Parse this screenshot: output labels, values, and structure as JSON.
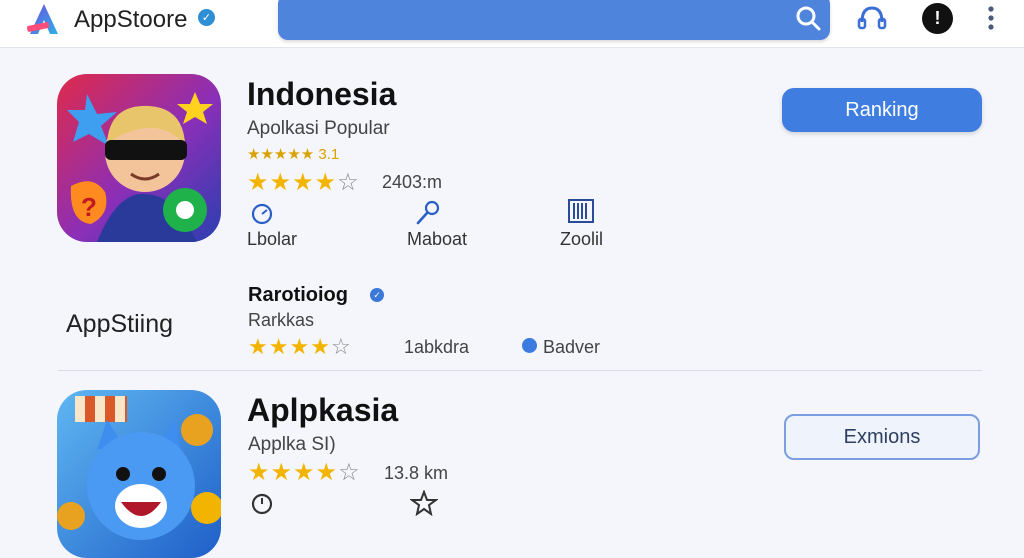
{
  "header": {
    "brand": "AppStoore",
    "colors": {
      "search_bar": "#4e84dc",
      "brand_badge": "#2f8fd6"
    },
    "icons": [
      "appstore-logo-icon",
      "verified-icon",
      "search-icon",
      "headset-icon",
      "alert-icon",
      "more-vertical-icon"
    ]
  },
  "featured": {
    "title": "Indonesia",
    "subtitle": "Apolkasi Popular",
    "small_rating_text": "★★★★★ 3.1",
    "rating_stars": 4,
    "downloads": "2403:m",
    "stats": [
      {
        "icon": "gauge-icon",
        "label": "Lbolar"
      },
      {
        "icon": "microphone-icon",
        "label": "Maboat"
      },
      {
        "icon": "barcode-icon",
        "label": "Zoolil"
      }
    ],
    "button_label": "Ranking"
  },
  "developer": {
    "side_label": "AppStiing",
    "title": "Rarotioiog",
    "subtitle": "Rarkkas",
    "rating_stars": 4,
    "count": "1abkdra",
    "badge_label": "Badver",
    "badge_color": "#3c7be0"
  },
  "second": {
    "title": "Aplpkasia",
    "subtitle": "Applka SI)",
    "rating_stars": 4,
    "downloads": "13.8 km",
    "button_label": "Exmions"
  }
}
